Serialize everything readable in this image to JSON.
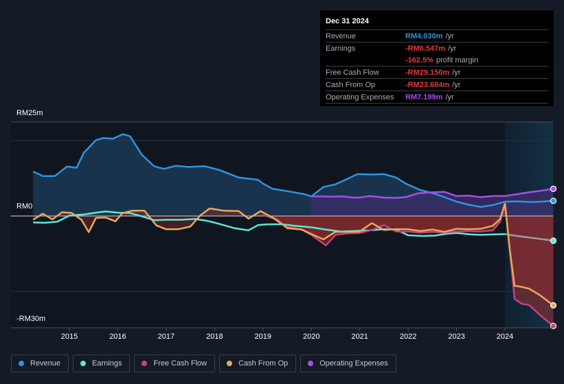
{
  "tooltip": {
    "date": "Dec 31 2024",
    "rows": [
      {
        "label": "Revenue",
        "value": "RM4.030m",
        "unit": "/yr",
        "color": "#2e94e0"
      },
      {
        "label": "Earnings",
        "value": "-RM6.547m",
        "unit": "/yr",
        "color": "#e23b3b"
      },
      {
        "label": "",
        "value": "-162.5%",
        "unit": "profit margin",
        "color": "#e23b3b"
      },
      {
        "label": "Free Cash Flow",
        "value": "-RM29.150m",
        "unit": "/yr",
        "color": "#e23b3b"
      },
      {
        "label": "Cash From Op",
        "value": "-RM23.684m",
        "unit": "/yr",
        "color": "#e23b3b"
      },
      {
        "label": "Operating Expenses",
        "value": "RM7.199m",
        "unit": "/yr",
        "color": "#a64ee8"
      }
    ]
  },
  "chart_data": {
    "type": "line",
    "title": "",
    "xlabel": "",
    "ylabel": "",
    "y_tick_labels": [
      "RM25m",
      "RM0",
      "-RM30m"
    ],
    "ylim": [
      -30,
      25
    ],
    "xlim": [
      2013.75,
      2025.0
    ],
    "x_ticks": [
      "2015",
      "2016",
      "2017",
      "2018",
      "2019",
      "2020",
      "2021",
      "2022",
      "2023",
      "2024"
    ],
    "forecast_highlight_start": 2024.0,
    "grid": true,
    "legend_position": "bottom-left",
    "series": [
      {
        "name": "Revenue",
        "color": "#2e94e0",
        "x": [
          2014.25,
          2014.45,
          2014.7,
          2014.95,
          2015.15,
          2015.3,
          2015.55,
          2015.7,
          2015.9,
          2016.1,
          2016.25,
          2016.5,
          2016.75,
          2016.95,
          2017.2,
          2017.45,
          2017.8,
          2018.1,
          2018.5,
          2018.9,
          2019.0,
          2019.2,
          2019.5,
          2019.85,
          2020.0,
          2020.25,
          2020.5,
          2020.75,
          2020.95,
          2021.25,
          2021.5,
          2021.75,
          2021.95,
          2022.25,
          2022.5,
          2022.75,
          2023.0,
          2023.25,
          2023.5,
          2023.75,
          2024.0,
          2024.25,
          2024.5,
          2024.75,
          2025.0
        ],
        "values": [
          11.8,
          10.6,
          10.6,
          13.1,
          12.8,
          16.8,
          20.1,
          20.7,
          20.5,
          21.7,
          21.2,
          16.2,
          13.2,
          12.5,
          13.3,
          13.0,
          13.2,
          12.2,
          10.2,
          9.6,
          8.6,
          7.2,
          6.6,
          5.8,
          5.2,
          7.7,
          8.4,
          9.9,
          11.1,
          11.0,
          11.1,
          10.2,
          8.6,
          6.9,
          6.1,
          5.0,
          3.8,
          3.0,
          2.4,
          2.9,
          3.8,
          3.9,
          3.7,
          3.8,
          4.03
        ]
      },
      {
        "name": "Earnings",
        "color": "#5ee8d6",
        "x": [
          2014.25,
          2014.5,
          2014.75,
          2015.0,
          2015.3,
          2015.55,
          2015.75,
          2016.0,
          2016.25,
          2016.5,
          2016.75,
          2017.0,
          2017.3,
          2017.6,
          2017.85,
          2018.1,
          2018.4,
          2018.7,
          2018.9,
          2019.1,
          2019.4,
          2019.65,
          2020.0,
          2020.3,
          2020.6,
          2020.85,
          2021.2,
          2021.5,
          2021.75,
          2022.0,
          2022.3,
          2022.55,
          2022.8,
          2023.0,
          2023.3,
          2023.5,
          2023.75,
          2024.0,
          2024.25,
          2024.5,
          2024.75,
          2025.0
        ],
        "values": [
          -1.7,
          -1.8,
          -1.5,
          0.1,
          0.4,
          0.9,
          1.2,
          0.9,
          0.8,
          -0.1,
          -1.1,
          -1.0,
          -1.0,
          -0.8,
          -1.3,
          -2.1,
          -3.2,
          -3.8,
          -2.4,
          -2.2,
          -2.2,
          -2.6,
          -3.0,
          -3.6,
          -4.1,
          -4.0,
          -3.8,
          -3.5,
          -3.6,
          -5.1,
          -5.3,
          -5.2,
          -4.7,
          -4.5,
          -4.9,
          -5.0,
          -4.9,
          -4.8,
          -5.3,
          -5.7,
          -6.1,
          -6.55
        ]
      },
      {
        "name": "Free Cash Flow",
        "color": "#c7427f",
        "x": [
          2019.0,
          2019.3,
          2019.5,
          2019.8,
          2020.0,
          2020.15,
          2020.3,
          2020.5,
          2020.75,
          2021.0,
          2021.25,
          2021.5,
          2021.75,
          2022.0,
          2022.25,
          2022.5,
          2022.75,
          2023.0,
          2023.25,
          2023.5,
          2023.75,
          2023.9,
          2024.0,
          2024.1,
          2024.2,
          2024.35,
          2024.5,
          2024.7,
          2025.0
        ],
        "values": [
          0.3,
          -1.0,
          -3.3,
          -3.6,
          -5.0,
          -6.4,
          -7.8,
          -5.0,
          -4.6,
          -4.5,
          -3.7,
          -2.4,
          -4.1,
          -4.1,
          -4.4,
          -4.2,
          -4.4,
          -4.1,
          -4.0,
          -4.1,
          -3.8,
          -1.5,
          3.6,
          -9.0,
          -22.0,
          -23.3,
          -23.6,
          -26.0,
          -29.15
        ]
      },
      {
        "name": "Cash From Op",
        "color": "#e8aa5c",
        "x": [
          2014.25,
          2014.45,
          2014.65,
          2014.85,
          2015.05,
          2015.25,
          2015.4,
          2015.55,
          2015.75,
          2015.95,
          2016.1,
          2016.3,
          2016.55,
          2016.8,
          2017.0,
          2017.25,
          2017.5,
          2017.7,
          2017.9,
          2018.2,
          2018.5,
          2018.7,
          2018.95,
          2019.2,
          2019.5,
          2019.8,
          2020.0,
          2020.25,
          2020.5,
          2020.8,
          2021.0,
          2021.25,
          2021.5,
          2021.75,
          2022.0,
          2022.25,
          2022.5,
          2022.75,
          2023.0,
          2023.25,
          2023.5,
          2023.75,
          2023.9,
          2024.0,
          2024.1,
          2024.2,
          2024.35,
          2024.5,
          2024.7,
          2025.0
        ],
        "values": [
          -1.0,
          0.6,
          -0.9,
          1.0,
          0.8,
          -1.0,
          -4.3,
          -0.5,
          -0.4,
          -1.4,
          0.8,
          1.4,
          1.4,
          -2.5,
          -3.5,
          -3.5,
          -2.8,
          0.1,
          2.0,
          1.4,
          1.3,
          -0.7,
          1.3,
          -0.4,
          -3.1,
          -3.6,
          -4.8,
          -6.2,
          -4.2,
          -4.2,
          -4.1,
          -1.9,
          -3.7,
          -3.5,
          -3.5,
          -4.0,
          -3.6,
          -4.2,
          -3.4,
          -3.5,
          -3.4,
          -2.6,
          -0.8,
          3.2,
          -9.0,
          -18.5,
          -18.8,
          -19.3,
          -20.8,
          -23.68
        ]
      },
      {
        "name": "Operating Expenses",
        "color": "#a64ee8",
        "x": [
          2020.0,
          2020.2,
          2020.45,
          2020.65,
          2020.85,
          2021.0,
          2021.2,
          2021.5,
          2021.75,
          2021.95,
          2022.2,
          2022.5,
          2022.75,
          2023.0,
          2023.25,
          2023.5,
          2023.75,
          2024.0,
          2024.25,
          2024.5,
          2024.75,
          2025.0
        ],
        "values": [
          5.2,
          5.2,
          5.1,
          5.2,
          4.9,
          4.9,
          5.3,
          4.9,
          4.8,
          5.0,
          6.0,
          6.3,
          6.4,
          5.3,
          5.4,
          5.0,
          5.3,
          5.3,
          5.8,
          6.3,
          6.7,
          7.2
        ]
      }
    ]
  },
  "legend": [
    {
      "label": "Revenue",
      "color": "#2e94e0"
    },
    {
      "label": "Earnings",
      "color": "#5ee8d6"
    },
    {
      "label": "Free Cash Flow",
      "color": "#c7427f"
    },
    {
      "label": "Cash From Op",
      "color": "#e8aa5c"
    },
    {
      "label": "Operating Expenses",
      "color": "#a64ee8"
    }
  ]
}
